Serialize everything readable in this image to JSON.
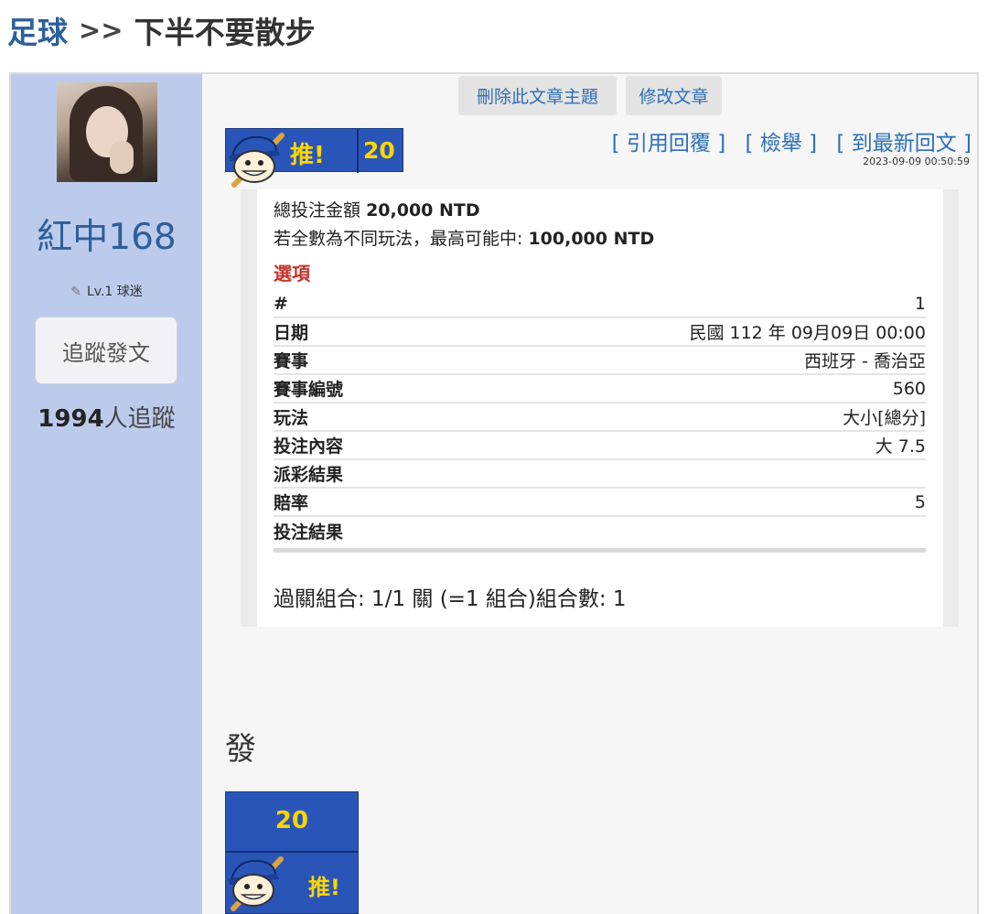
{
  "breadcrumb": {
    "section": "足球",
    "separator": ">>",
    "title": "下半不要散步"
  },
  "author": {
    "name": "紅中168",
    "level": "Lv.1 球迷",
    "follow_label": "追蹤發文",
    "followers_count": "1994",
    "followers_suffix": "人追蹤"
  },
  "post": {
    "delete_label": "刪除此文章主題",
    "edit_label": "修改文章",
    "push_label": "推!",
    "push_count": "20",
    "actions": {
      "quote": "[ 引用回覆 ]",
      "report": "[ 檢舉 ]",
      "latest": "[ 到最新回文 ]"
    },
    "timestamp": "2023-09-09 00:50:59",
    "body_text": "發"
  },
  "bet": {
    "total_label": "總投注金額",
    "total_value": "20,000 NTD",
    "max_label": "若全數為不同玩法，最高可能中:",
    "max_value": "100,000 NTD",
    "options_title": "選項",
    "rows": [
      {
        "key": "#",
        "value": "1"
      },
      {
        "key": "日期",
        "value": "民國 112 年 09月09日 00:00"
      },
      {
        "key": "賽事",
        "value": "西班牙 - 喬治亞"
      },
      {
        "key": "賽事編號",
        "value": "560"
      },
      {
        "key": "玩法",
        "value": "大小[總分]"
      },
      {
        "key": "投注內容",
        "value": "大 7.5"
      },
      {
        "key": "派彩結果",
        "value": ""
      },
      {
        "key": "賠率",
        "value": "5"
      },
      {
        "key": "投注結果",
        "value": ""
      }
    ],
    "combo": "過關組合: 1/1 關 (=1 組合)組合數: 1"
  },
  "colors": {
    "sidebar": "#bccbec",
    "link": "#2d6fb8",
    "push_bg": "#2a55b8",
    "push_text": "#ffd500",
    "options_title": "#c8312a"
  },
  "icons": {
    "mascot": "baseball-player-mascot-icon",
    "level": "pencil-icon"
  }
}
